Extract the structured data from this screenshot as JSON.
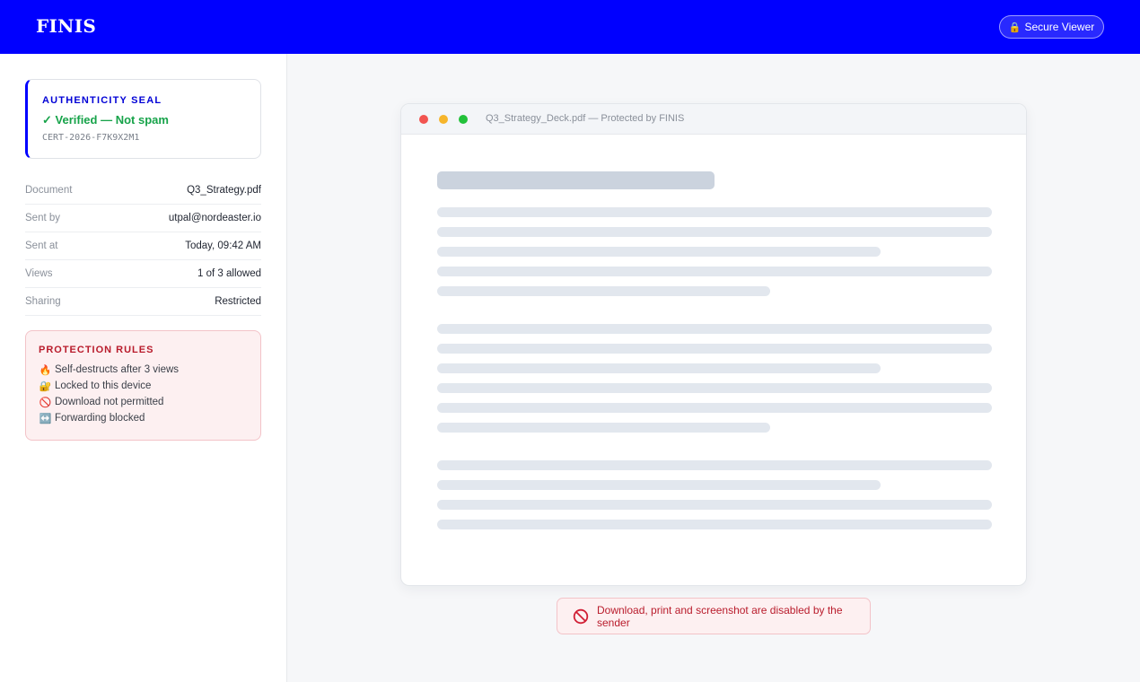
{
  "header": {
    "brand": "FINIS",
    "secure_viewer": "Secure Viewer",
    "secure_icon": "lock-icon"
  },
  "seal": {
    "title": "AUTHENTICITY SEAL",
    "status": "✓ Verified — Not spam",
    "cert_id": "CERT-2026-F7K9X2M1"
  },
  "meta": [
    {
      "label": "Document",
      "value": "Q3_Strategy.pdf"
    },
    {
      "label": "Sent by",
      "value": "utpal@nordeaster.io"
    },
    {
      "label": "Sent at",
      "value": "Today, 09:42 AM"
    },
    {
      "label": "Views",
      "value": "1 of 3 allowed"
    },
    {
      "label": "Sharing",
      "value": "Restricted"
    }
  ],
  "rules": {
    "title": "PROTECTION RULES",
    "items": [
      {
        "icon": "🔥",
        "icon_name": "fire-icon",
        "text": "Self-destructs after 3 views"
      },
      {
        "icon": "🔐",
        "icon_name": "lock-key-icon",
        "text": "Locked to this device"
      },
      {
        "icon": "🚫",
        "icon_name": "prohibited-icon",
        "text": "Download not permitted"
      },
      {
        "icon": "↔️",
        "icon_name": "left-right-arrow-icon",
        "text": "Forwarding blocked"
      }
    ]
  },
  "viewer": {
    "title": "Q3_Strategy_Deck.pdf — Protected by FINIS",
    "window_dots": [
      "#f25450",
      "#f6b52b",
      "#22c13a"
    ]
  },
  "notice": {
    "text": "Download, print and screenshot are disabled by the sender",
    "icon": "prohibited-icon"
  },
  "colors": {
    "brand": "#0000ff",
    "verified": "#17a34a",
    "danger": "#b91c2c"
  }
}
